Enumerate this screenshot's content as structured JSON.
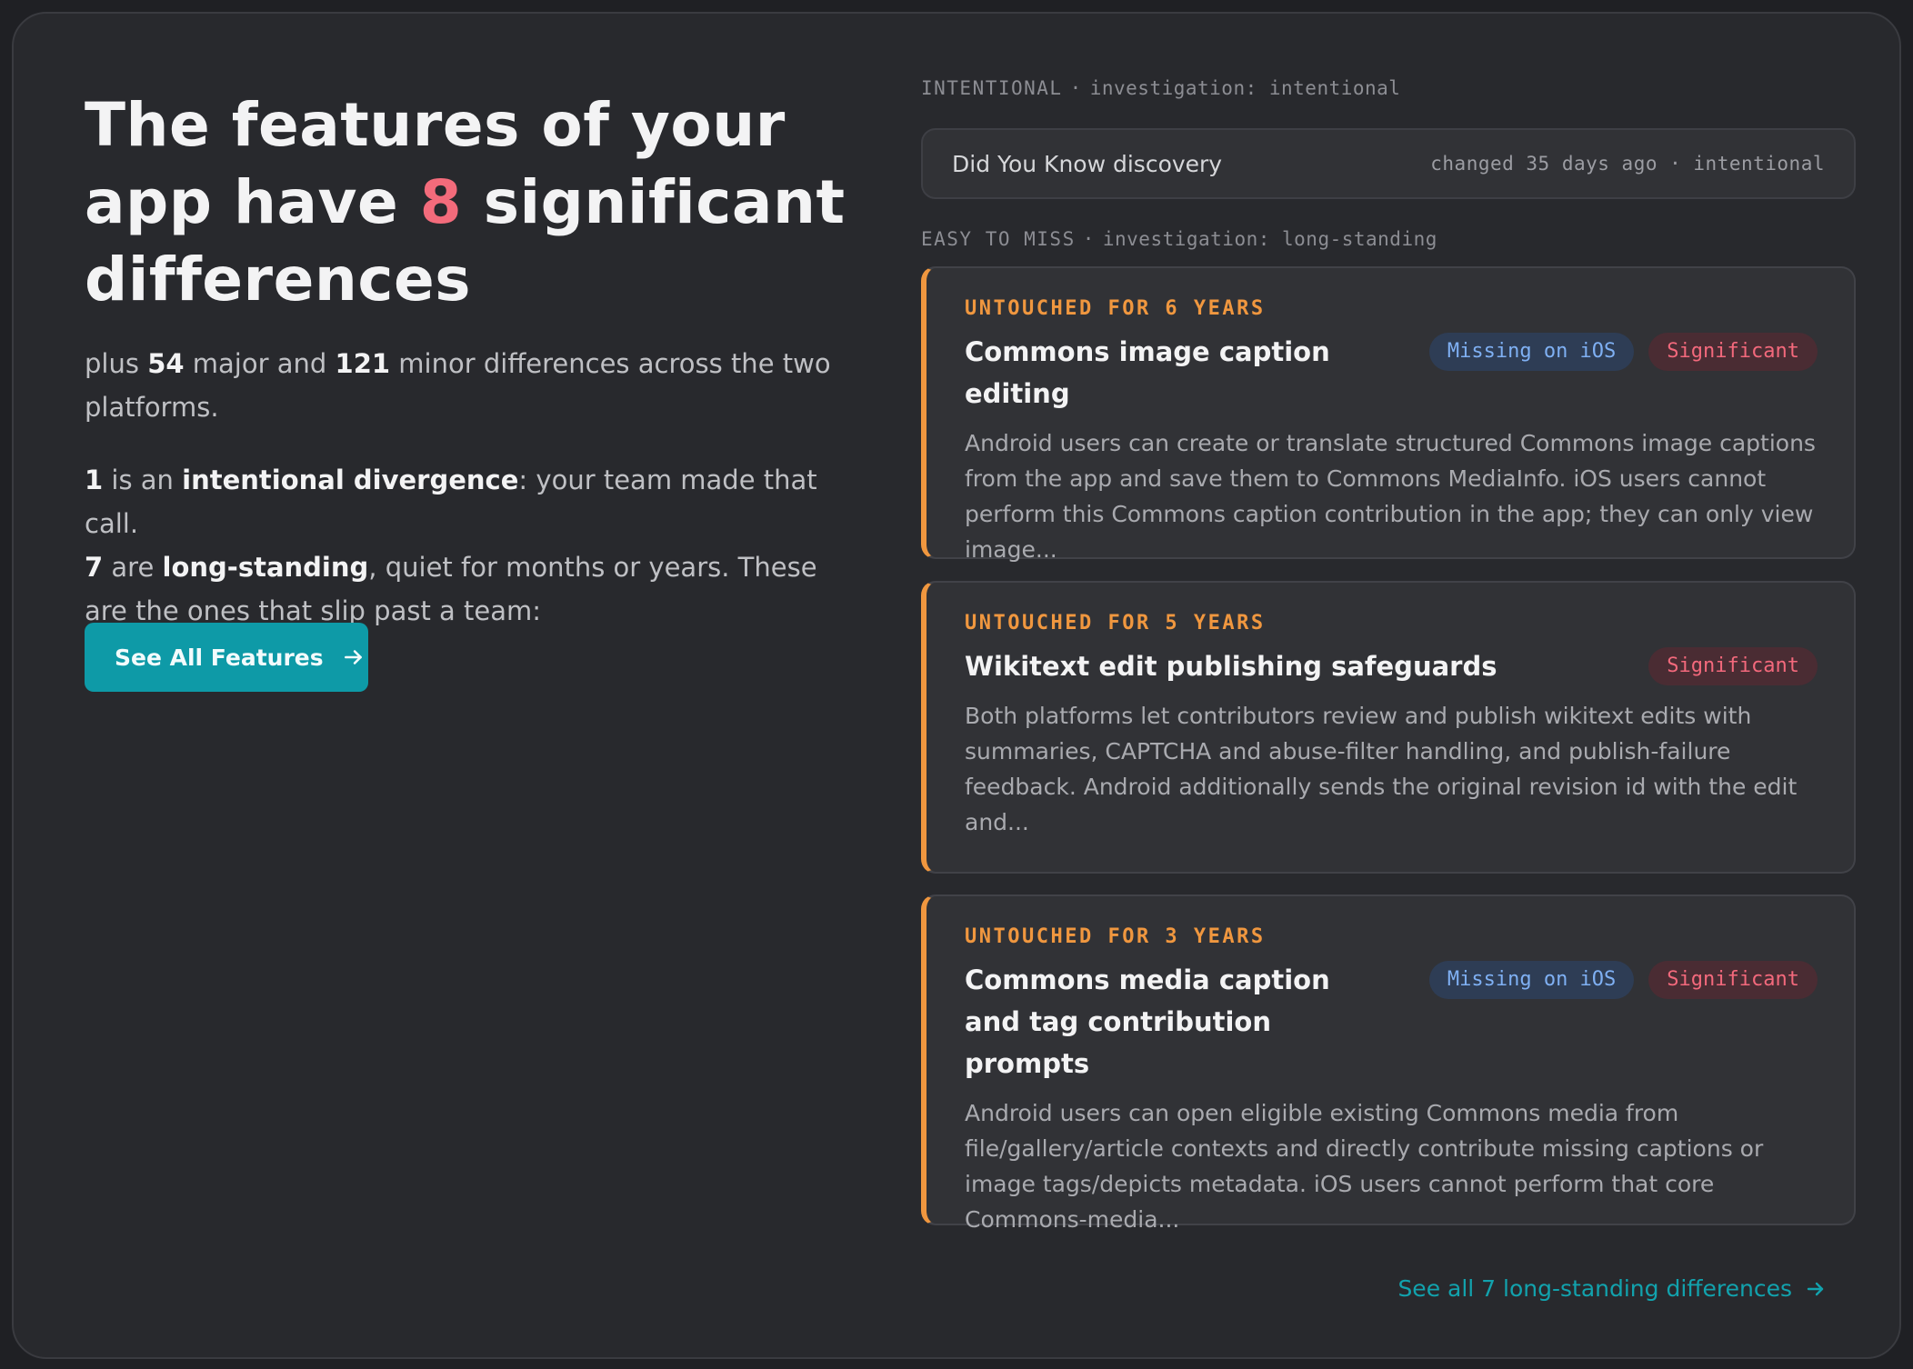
{
  "hero": {
    "title_a": "The features of your app have ",
    "title_num": "8",
    "title_b": " significant differences",
    "p1_a": "plus ",
    "p1_major": "54",
    "p1_b": " major and ",
    "p1_minor": "121",
    "p1_c": " minor differences across the two platforms.",
    "p2_num1": "1",
    "p2_a": " is an ",
    "p2_b1": "intentional divergence",
    "p2_b": ": your team made that call.",
    "p2_num2": "7",
    "p2_c": " are ",
    "p2_b2": "long-standing",
    "p2_d": ", quiet for months or years. These are the ones that slip past a team:",
    "button_label": "See All Features"
  },
  "intentional": {
    "label": "INTENTIONAL",
    "sub": "investigation: intentional",
    "item_title": "Did You Know discovery",
    "item_meta": "changed 35 days ago · intentional"
  },
  "easy_to_miss": {
    "label": "EASY TO MISS",
    "sub": "investigation: long-standing"
  },
  "cards": [
    {
      "kicker": "UNTOUCHED FOR 6 YEARS",
      "title": "Commons image caption editing",
      "badge_platform": "Missing on iOS",
      "badge_severity": "Significant",
      "desc": "Android users can create or translate structured Commons image captions from the app and save them to Commons MediaInfo. iOS users cannot perform this Commons caption contribution in the app; they can only view image..."
    },
    {
      "kicker": "UNTOUCHED FOR 5 YEARS",
      "title": "Wikitext edit publishing safeguards",
      "badge_severity": "Significant",
      "desc": "Both platforms let contributors review and publish wikitext edits with summaries, CAPTCHA and abuse-filter handling, and publish-failure feedback. Android additionally sends the original revision id with the edit and..."
    },
    {
      "kicker": "UNTOUCHED FOR 3 YEARS",
      "title": "Commons media caption and tag contribution prompts",
      "badge_platform": "Missing on iOS",
      "badge_severity": "Significant",
      "desc": "Android users can open eligible existing Commons media from file/gallery/article contexts and directly contribute missing captions or image tags/depicts metadata. iOS users cannot perform that core Commons-media..."
    }
  ],
  "footer_link": "See all 7 long-standing differences",
  "colors": {
    "accent_red": "#f36b7b",
    "accent_orange": "#f0973f",
    "button_teal": "#0e9aa7",
    "badge_blue_text": "#7fb0f3",
    "badge_red_text": "#f3697c"
  },
  "icons": [
    "arrow-right-icon"
  ]
}
